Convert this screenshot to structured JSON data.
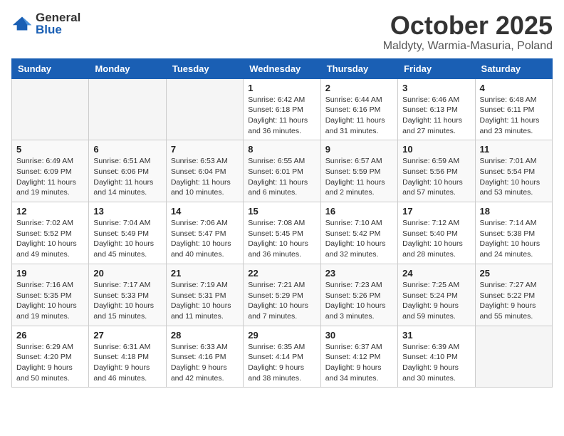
{
  "logo": {
    "general": "General",
    "blue": "Blue"
  },
  "title": "October 2025",
  "subtitle": "Maldyty, Warmia-Masuria, Poland",
  "weekdays": [
    "Sunday",
    "Monday",
    "Tuesday",
    "Wednesday",
    "Thursday",
    "Friday",
    "Saturday"
  ],
  "weeks": [
    [
      {
        "day": "",
        "info": ""
      },
      {
        "day": "",
        "info": ""
      },
      {
        "day": "",
        "info": ""
      },
      {
        "day": "1",
        "info": "Sunrise: 6:42 AM\nSunset: 6:18 PM\nDaylight: 11 hours\nand 36 minutes."
      },
      {
        "day": "2",
        "info": "Sunrise: 6:44 AM\nSunset: 6:16 PM\nDaylight: 11 hours\nand 31 minutes."
      },
      {
        "day": "3",
        "info": "Sunrise: 6:46 AM\nSunset: 6:13 PM\nDaylight: 11 hours\nand 27 minutes."
      },
      {
        "day": "4",
        "info": "Sunrise: 6:48 AM\nSunset: 6:11 PM\nDaylight: 11 hours\nand 23 minutes."
      }
    ],
    [
      {
        "day": "5",
        "info": "Sunrise: 6:49 AM\nSunset: 6:09 PM\nDaylight: 11 hours\nand 19 minutes."
      },
      {
        "day": "6",
        "info": "Sunrise: 6:51 AM\nSunset: 6:06 PM\nDaylight: 11 hours\nand 14 minutes."
      },
      {
        "day": "7",
        "info": "Sunrise: 6:53 AM\nSunset: 6:04 PM\nDaylight: 11 hours\nand 10 minutes."
      },
      {
        "day": "8",
        "info": "Sunrise: 6:55 AM\nSunset: 6:01 PM\nDaylight: 11 hours\nand 6 minutes."
      },
      {
        "day": "9",
        "info": "Sunrise: 6:57 AM\nSunset: 5:59 PM\nDaylight: 11 hours\nand 2 minutes."
      },
      {
        "day": "10",
        "info": "Sunrise: 6:59 AM\nSunset: 5:56 PM\nDaylight: 10 hours\nand 57 minutes."
      },
      {
        "day": "11",
        "info": "Sunrise: 7:01 AM\nSunset: 5:54 PM\nDaylight: 10 hours\nand 53 minutes."
      }
    ],
    [
      {
        "day": "12",
        "info": "Sunrise: 7:02 AM\nSunset: 5:52 PM\nDaylight: 10 hours\nand 49 minutes."
      },
      {
        "day": "13",
        "info": "Sunrise: 7:04 AM\nSunset: 5:49 PM\nDaylight: 10 hours\nand 45 minutes."
      },
      {
        "day": "14",
        "info": "Sunrise: 7:06 AM\nSunset: 5:47 PM\nDaylight: 10 hours\nand 40 minutes."
      },
      {
        "day": "15",
        "info": "Sunrise: 7:08 AM\nSunset: 5:45 PM\nDaylight: 10 hours\nand 36 minutes."
      },
      {
        "day": "16",
        "info": "Sunrise: 7:10 AM\nSunset: 5:42 PM\nDaylight: 10 hours\nand 32 minutes."
      },
      {
        "day": "17",
        "info": "Sunrise: 7:12 AM\nSunset: 5:40 PM\nDaylight: 10 hours\nand 28 minutes."
      },
      {
        "day": "18",
        "info": "Sunrise: 7:14 AM\nSunset: 5:38 PM\nDaylight: 10 hours\nand 24 minutes."
      }
    ],
    [
      {
        "day": "19",
        "info": "Sunrise: 7:16 AM\nSunset: 5:35 PM\nDaylight: 10 hours\nand 19 minutes."
      },
      {
        "day": "20",
        "info": "Sunrise: 7:17 AM\nSunset: 5:33 PM\nDaylight: 10 hours\nand 15 minutes."
      },
      {
        "day": "21",
        "info": "Sunrise: 7:19 AM\nSunset: 5:31 PM\nDaylight: 10 hours\nand 11 minutes."
      },
      {
        "day": "22",
        "info": "Sunrise: 7:21 AM\nSunset: 5:29 PM\nDaylight: 10 hours\nand 7 minutes."
      },
      {
        "day": "23",
        "info": "Sunrise: 7:23 AM\nSunset: 5:26 PM\nDaylight: 10 hours\nand 3 minutes."
      },
      {
        "day": "24",
        "info": "Sunrise: 7:25 AM\nSunset: 5:24 PM\nDaylight: 9 hours\nand 59 minutes."
      },
      {
        "day": "25",
        "info": "Sunrise: 7:27 AM\nSunset: 5:22 PM\nDaylight: 9 hours\nand 55 minutes."
      }
    ],
    [
      {
        "day": "26",
        "info": "Sunrise: 6:29 AM\nSunset: 4:20 PM\nDaylight: 9 hours\nand 50 minutes."
      },
      {
        "day": "27",
        "info": "Sunrise: 6:31 AM\nSunset: 4:18 PM\nDaylight: 9 hours\nand 46 minutes."
      },
      {
        "day": "28",
        "info": "Sunrise: 6:33 AM\nSunset: 4:16 PM\nDaylight: 9 hours\nand 42 minutes."
      },
      {
        "day": "29",
        "info": "Sunrise: 6:35 AM\nSunset: 4:14 PM\nDaylight: 9 hours\nand 38 minutes."
      },
      {
        "day": "30",
        "info": "Sunrise: 6:37 AM\nSunset: 4:12 PM\nDaylight: 9 hours\nand 34 minutes."
      },
      {
        "day": "31",
        "info": "Sunrise: 6:39 AM\nSunset: 4:10 PM\nDaylight: 9 hours\nand 30 minutes."
      },
      {
        "day": "",
        "info": ""
      }
    ]
  ]
}
